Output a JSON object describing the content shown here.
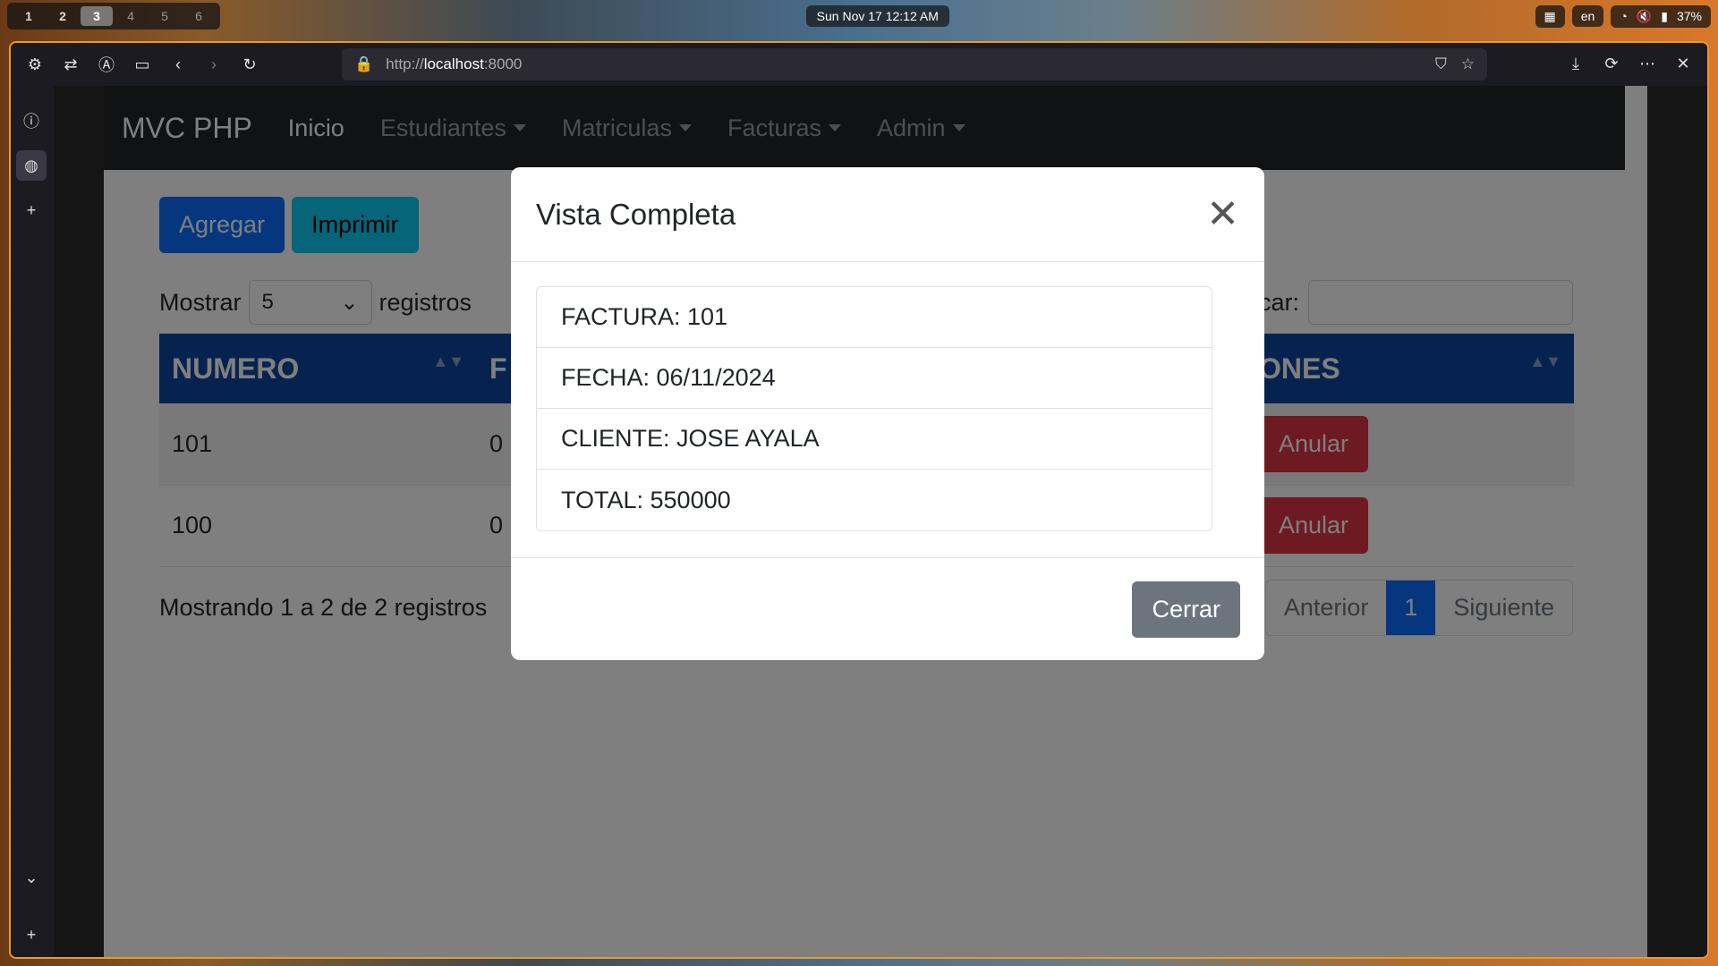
{
  "system": {
    "workspaces": [
      "1",
      "2",
      "3",
      "4",
      "5",
      "6"
    ],
    "active_workspace": "3",
    "clock": "Sun Nov 17  12:12 AM",
    "language": "en",
    "battery": "37%"
  },
  "browser": {
    "url_protocol": "http://",
    "url_host": "localhost",
    "url_port": ":8000"
  },
  "navbar": {
    "brand": "MVC PHP",
    "links": [
      "Inicio",
      "Estudiantes",
      "Matriculas",
      "Facturas",
      "Admin"
    ]
  },
  "actions": {
    "add_label": "Agregar",
    "print_label": "Imprimir"
  },
  "table_controls": {
    "show_label": "Mostrar",
    "page_size": "5",
    "records_label": "registros",
    "search_label": "Buscar:"
  },
  "table": {
    "headers": [
      "NUMERO",
      "F",
      "ONES"
    ],
    "rows": [
      {
        "numero": "101",
        "fecha_partial": "0",
        "action": "Anular"
      },
      {
        "numero": "100",
        "fecha_partial": "0",
        "action": "Anular"
      }
    ]
  },
  "footer": {
    "info": "Mostrando 1 a 2 de 2 registros",
    "prev": "Anterior",
    "current_page": "1",
    "next": "Siguiente"
  },
  "modal": {
    "title": "Vista Completa",
    "items": [
      "FACTURA: 101",
      "FECHA: 06/11/2024",
      "CLIENTE: JOSE AYALA",
      "TOTAL: 550000"
    ],
    "close_label": "Cerrar"
  }
}
